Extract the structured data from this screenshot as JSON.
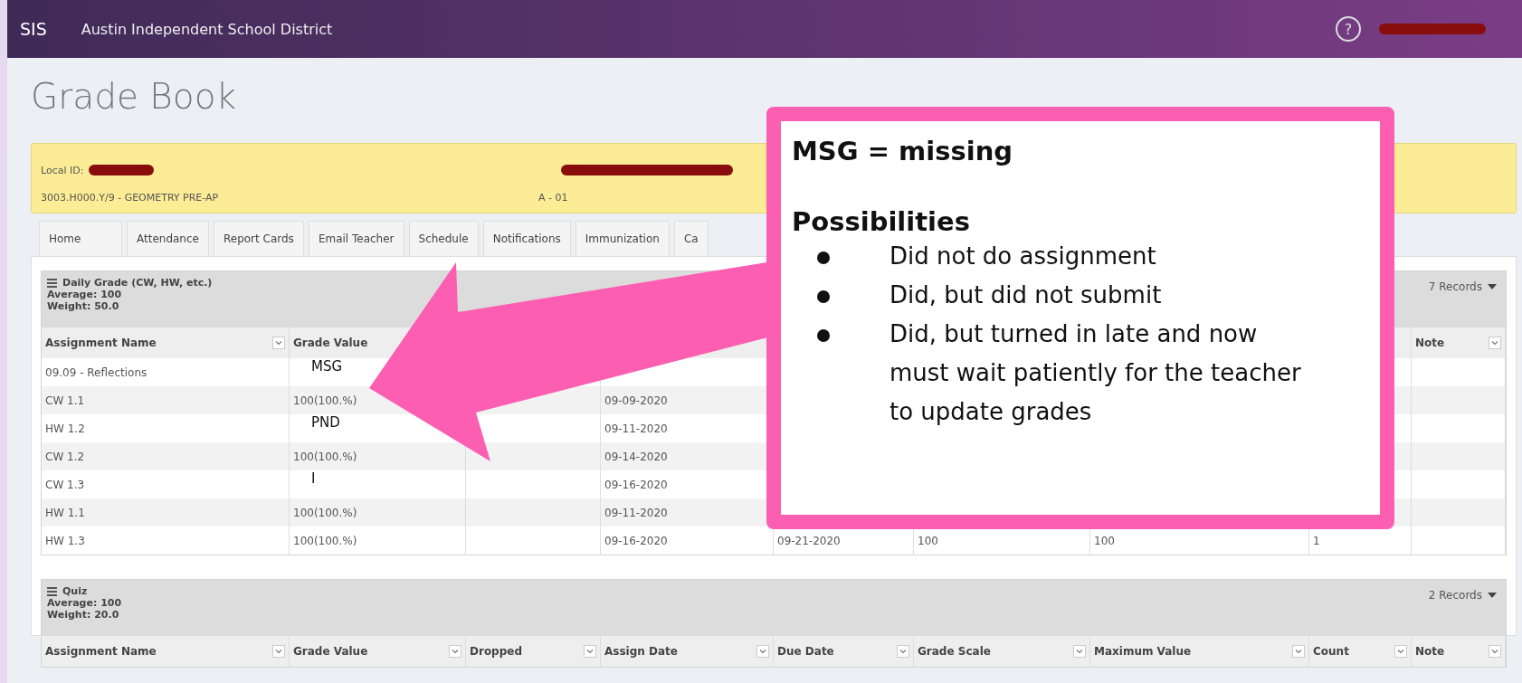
{
  "header": {
    "brand": "SIS",
    "district": "Austin Independent School District",
    "help": "?"
  },
  "title": "Grade Book",
  "info": {
    "local_id_label": "Local ID:",
    "course": "3003.H000.Y/9 - GEOMETRY PRE-AP",
    "section": "A - 01"
  },
  "tabs": [
    "Home",
    "Attendance",
    "Report Cards",
    "Email Teacher",
    "Schedule",
    "Notifications",
    "Immunization",
    "Ca"
  ],
  "sections": [
    {
      "name": "Daily Grade (CW, HW, etc.)",
      "average": "Average: 100",
      "weight": "Weight: 50.0",
      "records": "7 Records",
      "columns": [
        {
          "label": "Assignment Name"
        },
        {
          "label": "Grade Value"
        },
        {},
        {},
        {},
        {},
        {},
        {},
        {
          "label": "Note"
        }
      ],
      "rows": [
        {
          "annotated": true,
          "cells": [
            "09.09 - Reflections",
            "MSG",
            null,
            null,
            null,
            null,
            null,
            null,
            null
          ]
        },
        {
          "annotated": false,
          "cells": [
            "CW 1.1",
            "100(100.%)",
            null,
            "09-09-2020",
            null,
            null,
            null,
            null,
            null
          ]
        },
        {
          "annotated": true,
          "cells": [
            "HW 1.2",
            "PND",
            null,
            "09-11-2020",
            null,
            null,
            null,
            null,
            null
          ]
        },
        {
          "annotated": false,
          "cells": [
            "CW 1.2",
            "100(100.%)",
            null,
            "09-14-2020",
            null,
            null,
            null,
            null,
            null
          ]
        },
        {
          "annotated": true,
          "cells": [
            "CW 1.3",
            "I",
            null,
            "09-16-2020",
            null,
            null,
            null,
            null,
            null
          ]
        },
        {
          "annotated": false,
          "cells": [
            "HW 1.1",
            "100(100.%)",
            null,
            "09-11-2020",
            null,
            null,
            null,
            null,
            null
          ]
        },
        {
          "annotated": false,
          "cells": [
            "HW 1.3",
            "100(100.%)",
            null,
            "09-16-2020",
            "09-21-2020",
            "100",
            "100",
            "1",
            null
          ]
        }
      ]
    },
    {
      "name": "Quiz",
      "average": "Average: 100",
      "weight": "Weight: 20.0",
      "records": "2 Records",
      "columns": [
        {
          "label": "Assignment Name"
        },
        {
          "label": "Grade Value"
        },
        {
          "label": "Dropped"
        },
        {
          "label": "Assign Date"
        },
        {
          "label": "Due Date"
        },
        {
          "label": "Grade Scale"
        },
        {
          "label": "Maximum Value"
        },
        {
          "label": "Count"
        },
        {
          "label": "Note"
        }
      ]
    }
  ],
  "callout": {
    "title": "MSG = missing",
    "subtitle": "Possibilities",
    "bullets": [
      "Did not do assignment",
      "Did, but did not submit",
      "Did, but turned in late and now must wait patiently for the teacher to update grades"
    ]
  }
}
